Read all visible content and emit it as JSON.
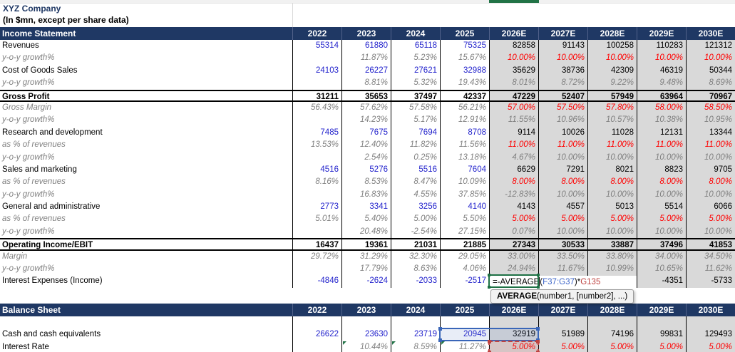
{
  "header": {
    "company": "XYZ Company",
    "subtitle": "(In $mn, except per share data)"
  },
  "columns": [
    "2022",
    "2023",
    "2024",
    "2025",
    "2026E",
    "2027E",
    "2028E",
    "2029E",
    "2030E"
  ],
  "colors": {
    "header_navy": "#1F3864",
    "input_blue": "#2222CC",
    "assumption_red": "#FF0000",
    "muted_gray": "#808080",
    "forecast_bg": "#D9D9D9",
    "range_ref_blue": "#3E66C9",
    "cell_ref_red": "#BF4341",
    "excel_green": "#1E7145"
  },
  "income_statement": {
    "title": "Income Statement",
    "rows": [
      {
        "l": "Revenues",
        "lc": "",
        "v": [
          "55314",
          "61880",
          "65118",
          "75325",
          "82858",
          "91143",
          "100258",
          "110283",
          "121312"
        ],
        "s": [
          "b",
          "b",
          "b",
          "b",
          "k",
          "k",
          "k",
          "k",
          "k"
        ]
      },
      {
        "l": "y-o-y growth%",
        "lc": "g",
        "v": [
          "",
          "11.87%",
          "5.23%",
          "15.67%",
          "10.00%",
          "10.00%",
          "10.00%",
          "10.00%",
          "10.00%"
        ],
        "s": [
          "",
          "g",
          "g",
          "g",
          "r",
          "r",
          "r",
          "r",
          "r"
        ]
      },
      {
        "l": "Cost of Goods Sales",
        "lc": "",
        "v": [
          "24103",
          "26227",
          "27621",
          "32988",
          "35629",
          "38736",
          "42309",
          "46319",
          "50344"
        ],
        "s": [
          "b",
          "b",
          "b",
          "b",
          "k",
          "k",
          "k",
          "k",
          "k"
        ]
      },
      {
        "l": "y-o-y growth%",
        "lc": "g",
        "v": [
          "",
          "8.81%",
          "5.32%",
          "19.43%",
          "8.01%",
          "8.72%",
          "9.22%",
          "9.48%",
          "8.69%"
        ],
        "s": [
          "",
          "g",
          "g",
          "g",
          "g",
          "g",
          "g",
          "g",
          "g"
        ]
      },
      {
        "l": "Gross Profit",
        "lc": "b",
        "total": true,
        "v": [
          "31211",
          "35653",
          "37497",
          "42337",
          "47229",
          "52407",
          "57949",
          "63964",
          "70967"
        ],
        "s": [
          "kb",
          "kb",
          "kb",
          "kb",
          "kb",
          "kb",
          "kb",
          "kb",
          "kb"
        ]
      },
      {
        "l": "Gross Margin",
        "lc": "g",
        "v": [
          "56.43%",
          "57.62%",
          "57.58%",
          "56.21%",
          "57.00%",
          "57.50%",
          "57.80%",
          "58.00%",
          "58.50%"
        ],
        "s": [
          "g",
          "g",
          "g",
          "g",
          "r",
          "r",
          "r",
          "r",
          "r"
        ]
      },
      {
        "l": "y-o-y growth%",
        "lc": "g",
        "v": [
          "",
          "14.23%",
          "5.17%",
          "12.91%",
          "11.55%",
          "10.96%",
          "10.57%",
          "10.38%",
          "10.95%"
        ],
        "s": [
          "",
          "g",
          "g",
          "g",
          "g",
          "g",
          "g",
          "g",
          "g"
        ]
      },
      {
        "l": "Research and development",
        "lc": "",
        "v": [
          "7485",
          "7675",
          "7694",
          "8708",
          "9114",
          "10026",
          "11028",
          "12131",
          "13344"
        ],
        "s": [
          "b",
          "b",
          "b",
          "b",
          "k",
          "k",
          "k",
          "k",
          "k"
        ]
      },
      {
        "l": "as % of revenues",
        "lc": "g",
        "v": [
          "13.53%",
          "12.40%",
          "11.82%",
          "11.56%",
          "11.00%",
          "11.00%",
          "11.00%",
          "11.00%",
          "11.00%"
        ],
        "s": [
          "g",
          "g",
          "g",
          "g",
          "r",
          "r",
          "r",
          "r",
          "r"
        ]
      },
      {
        "l": "y-o-y growth%",
        "lc": "g",
        "v": [
          "",
          "2.54%",
          "0.25%",
          "13.18%",
          "4.67%",
          "10.00%",
          "10.00%",
          "10.00%",
          "10.00%"
        ],
        "s": [
          "",
          "g",
          "g",
          "g",
          "g",
          "g",
          "g",
          "g",
          "g"
        ]
      },
      {
        "l": "Sales and marketing",
        "lc": "",
        "v": [
          "4516",
          "5276",
          "5516",
          "7604",
          "6629",
          "7291",
          "8021",
          "8823",
          "9705"
        ],
        "s": [
          "b",
          "b",
          "b",
          "b",
          "k",
          "k",
          "k",
          "k",
          "k"
        ]
      },
      {
        "l": "as % of revenues",
        "lc": "g",
        "v": [
          "8.16%",
          "8.53%",
          "8.47%",
          "10.09%",
          "8.00%",
          "8.00%",
          "8.00%",
          "8.00%",
          "8.00%"
        ],
        "s": [
          "g",
          "g",
          "g",
          "g",
          "r",
          "r",
          "r",
          "r",
          "r"
        ]
      },
      {
        "l": "y-o-y growth%",
        "lc": "g",
        "v": [
          "",
          "16.83%",
          "4.55%",
          "37.85%",
          "-12.83%",
          "10.00%",
          "10.00%",
          "10.00%",
          "10.00%"
        ],
        "s": [
          "",
          "g",
          "g",
          "g",
          "g",
          "g",
          "g",
          "g",
          "g"
        ]
      },
      {
        "l": "General and administrative",
        "lc": "",
        "v": [
          "2773",
          "3341",
          "3256",
          "4140",
          "4143",
          "4557",
          "5013",
          "5514",
          "6066"
        ],
        "s": [
          "b",
          "b",
          "b",
          "b",
          "k",
          "k",
          "k",
          "k",
          "k"
        ]
      },
      {
        "l": "as % of revenues",
        "lc": "g",
        "v": [
          "5.01%",
          "5.40%",
          "5.00%",
          "5.50%",
          "5.00%",
          "5.00%",
          "5.00%",
          "5.00%",
          "5.00%"
        ],
        "s": [
          "g",
          "g",
          "g",
          "g",
          "r",
          "r",
          "r",
          "r",
          "r"
        ]
      },
      {
        "l": "y-o-y growth%",
        "lc": "g",
        "v": [
          "",
          "20.48%",
          "-2.54%",
          "27.15%",
          "0.07%",
          "10.00%",
          "10.00%",
          "10.00%",
          "10.00%"
        ],
        "s": [
          "",
          "g",
          "g",
          "g",
          "g",
          "g",
          "g",
          "g",
          "g"
        ]
      },
      {
        "l": "Operating Income/EBIT",
        "lc": "b",
        "total": true,
        "v": [
          "16437",
          "19361",
          "21031",
          "21885",
          "27343",
          "30533",
          "33887",
          "37496",
          "41853"
        ],
        "s": [
          "kb",
          "kb",
          "kb",
          "kb",
          "kb",
          "kb",
          "kb",
          "kb",
          "kb"
        ]
      },
      {
        "l": "Margin",
        "lc": "g",
        "v": [
          "29.72%",
          "31.29%",
          "32.30%",
          "29.05%",
          "33.00%",
          "33.50%",
          "33.80%",
          "34.00%",
          "34.50%"
        ],
        "s": [
          "g",
          "g",
          "g",
          "g",
          "g",
          "g",
          "g",
          "g",
          "g"
        ]
      },
      {
        "l": "y-o-y growth%",
        "lc": "g",
        "v": [
          "",
          "17.79%",
          "8.63%",
          "4.06%",
          "24.94%",
          "11.67%",
          "10.99%",
          "10.65%",
          "11.62%"
        ],
        "s": [
          "",
          "g",
          "g",
          "g",
          "g",
          "g",
          "g",
          "g",
          "g"
        ]
      },
      {
        "l": "Interest Expenses (Income)",
        "lc": "",
        "v": [
          "-4846",
          "-2624",
          "-2033",
          "-2517",
          "",
          "",
          "",
          "-4351",
          "-5733"
        ],
        "s": [
          "b",
          "b",
          "b",
          "b",
          "",
          "",
          "",
          "k",
          "k"
        ]
      }
    ]
  },
  "balance_sheet": {
    "title": "Balance Sheet",
    "rows": [
      {
        "l": "",
        "lc": "",
        "v": [
          "",
          "",
          "",
          "",
          "",
          "",
          "",
          "",
          ""
        ],
        "s": [
          "",
          "",
          "",
          "",
          "",
          "",
          "",
          "",
          ""
        ]
      },
      {
        "l": "Cash and cash equivalents",
        "lc": "",
        "v": [
          "26622",
          "23630",
          "23719",
          "20945",
          "32919",
          "51989",
          "74196",
          "99831",
          "129493"
        ],
        "s": [
          "b",
          "b",
          "b",
          "b",
          "k",
          "k",
          "k",
          "k",
          "k"
        ]
      },
      {
        "l": "Interest Rate",
        "lc": "",
        "v": [
          "",
          "10.44%",
          "8.59%",
          "11.27%",
          "5.00%",
          "5.00%",
          "5.00%",
          "5.00%",
          "5.00%"
        ],
        "s": [
          "",
          "g",
          "g",
          "g",
          "r",
          "r",
          "r",
          "r",
          "r"
        ],
        "flags": [
          1,
          2,
          3
        ]
      }
    ]
  },
  "formula": {
    "parts": [
      {
        "t": "=-AVERAGE",
        "c": "k",
        "caret_after": true
      },
      {
        "t": "(",
        "c": "k"
      },
      {
        "t": "F37:G37",
        "c": "b"
      },
      {
        "t": ")*",
        "c": "k"
      },
      {
        "t": "G135",
        "c": "r"
      }
    ]
  },
  "tooltip": {
    "bold": "AVERAGE",
    "rest": "(number1, [number2], ...)"
  }
}
